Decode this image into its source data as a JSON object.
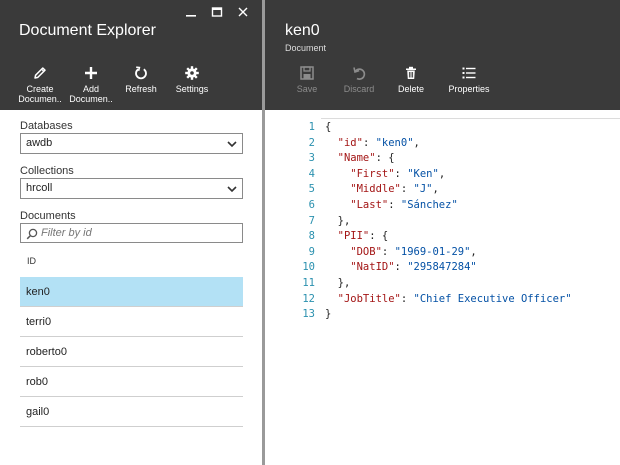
{
  "left_blade": {
    "title": "Document Explorer",
    "toolbar": [
      {
        "label": "Create\nDocumen..",
        "icon": "pencil-icon"
      },
      {
        "label": "Add\nDocumen..",
        "icon": "plus-icon"
      },
      {
        "label": "Refresh",
        "icon": "refresh-icon"
      },
      {
        "label": "Settings",
        "icon": "gear-icon"
      }
    ],
    "databases": {
      "label": "Databases",
      "value": "awdb"
    },
    "collections": {
      "label": "Collections",
      "value": "hrcoll"
    },
    "documents": {
      "label": "Documents",
      "filter_placeholder": "Filter by id",
      "column_header": "ID",
      "items": [
        "ken0",
        "terri0",
        "roberto0",
        "rob0",
        "gail0"
      ],
      "selected": "ken0"
    }
  },
  "right_blade": {
    "title": "ken0",
    "subtitle": "Document",
    "toolbar": [
      {
        "label": "Save",
        "icon": "save-icon",
        "enabled": false
      },
      {
        "label": "Discard",
        "icon": "undo-icon",
        "enabled": false
      },
      {
        "label": "Delete",
        "icon": "trash-icon",
        "enabled": true
      },
      {
        "label": "Properties",
        "icon": "list-icon",
        "enabled": true
      }
    ],
    "editor": {
      "line_numbers": [
        "1",
        "2",
        "3",
        "4",
        "5",
        "6",
        "7",
        "8",
        "9",
        "10",
        "11",
        "12",
        "13"
      ],
      "lines": [
        [
          {
            "t": "p",
            "v": "{"
          }
        ],
        [
          {
            "t": "k",
            "v": "  \"id\""
          },
          {
            "t": "p",
            "v": ": "
          },
          {
            "t": "s",
            "v": "\"ken0\""
          },
          {
            "t": "p",
            "v": ","
          }
        ],
        [
          {
            "t": "k",
            "v": "  \"Name\""
          },
          {
            "t": "p",
            "v": ": {"
          }
        ],
        [
          {
            "t": "k",
            "v": "    \"First\""
          },
          {
            "t": "p",
            "v": ": "
          },
          {
            "t": "s",
            "v": "\"Ken\""
          },
          {
            "t": "p",
            "v": ","
          }
        ],
        [
          {
            "t": "k",
            "v": "    \"Middle\""
          },
          {
            "t": "p",
            "v": ": "
          },
          {
            "t": "s",
            "v": "\"J\""
          },
          {
            "t": "p",
            "v": ","
          }
        ],
        [
          {
            "t": "k",
            "v": "    \"Last\""
          },
          {
            "t": "p",
            "v": ": "
          },
          {
            "t": "s",
            "v": "\"Sánchez\""
          }
        ],
        [
          {
            "t": "p",
            "v": "  },"
          }
        ],
        [
          {
            "t": "k",
            "v": "  \"PII\""
          },
          {
            "t": "p",
            "v": ": {"
          }
        ],
        [
          {
            "t": "k",
            "v": "    \"DOB\""
          },
          {
            "t": "p",
            "v": ": "
          },
          {
            "t": "s",
            "v": "\"1969-01-29\""
          },
          {
            "t": "p",
            "v": ","
          }
        ],
        [
          {
            "t": "k",
            "v": "    \"NatID\""
          },
          {
            "t": "p",
            "v": ": "
          },
          {
            "t": "s",
            "v": "\"295847284\""
          }
        ],
        [
          {
            "t": "p",
            "v": "  },"
          }
        ],
        [
          {
            "t": "k",
            "v": "  \"JobTitle\""
          },
          {
            "t": "p",
            "v": ": "
          },
          {
            "t": "s",
            "v": "\"Chief Executive Officer\""
          }
        ],
        [
          {
            "t": "p",
            "v": "}"
          }
        ]
      ]
    }
  },
  "colors": {
    "header_bg": "#3a3a3a",
    "selected_row": "#b3e1f5",
    "json_key": "#a31515",
    "json_string": "#0451a5",
    "line_number": "#2b91af"
  }
}
